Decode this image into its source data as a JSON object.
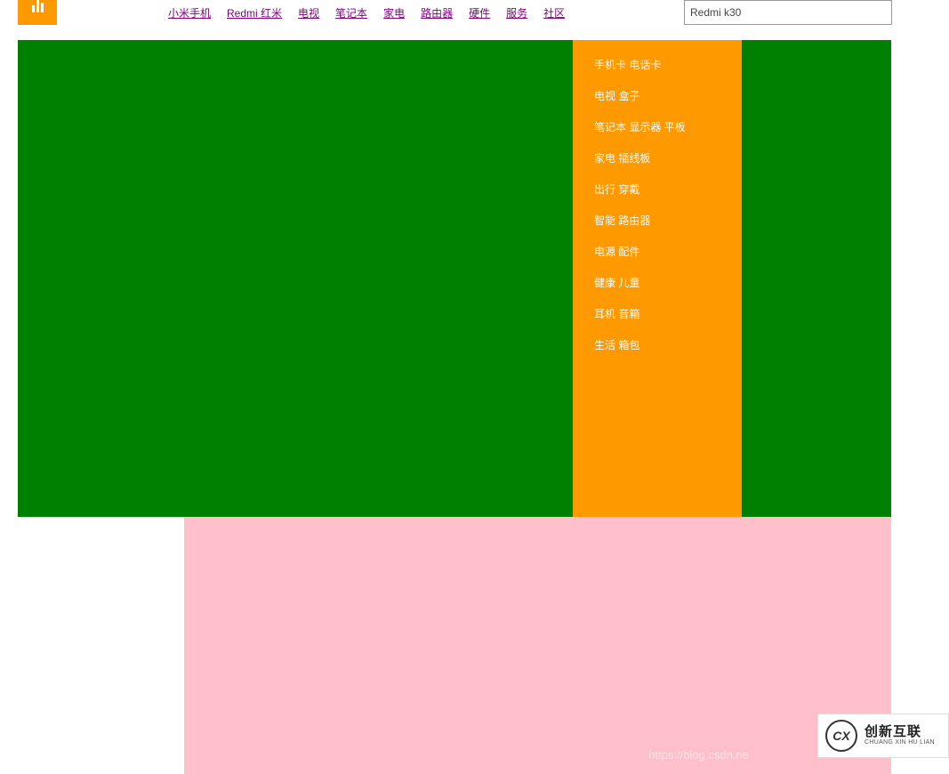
{
  "header": {
    "logo_alt": "MI",
    "nav": [
      "小米手机",
      "Redmi 红米",
      "电视",
      "笔记本",
      "家电",
      "路由器",
      "硬件",
      "服务",
      "社区"
    ],
    "search_value": "Redmi k30"
  },
  "side_menu": [
    "手机卡 电话卡",
    "电视 盒子",
    "笔记本 显示器 平板",
    "家电 插线板",
    "出行 穿戴",
    "智能 路由器",
    "电源 配件",
    "健康 儿童",
    "耳机 音箱",
    "生活 箱包"
  ],
  "watermark": "https://blog.csdn.ne",
  "corner_logo": {
    "icon": "CX",
    "cn": "创新互联",
    "en": "CHUANG XIN HU LIAN"
  },
  "colors": {
    "orange": "#ff9900",
    "green": "#008000",
    "pink": "#ffc0cb",
    "nav_link": "#7f007f"
  }
}
